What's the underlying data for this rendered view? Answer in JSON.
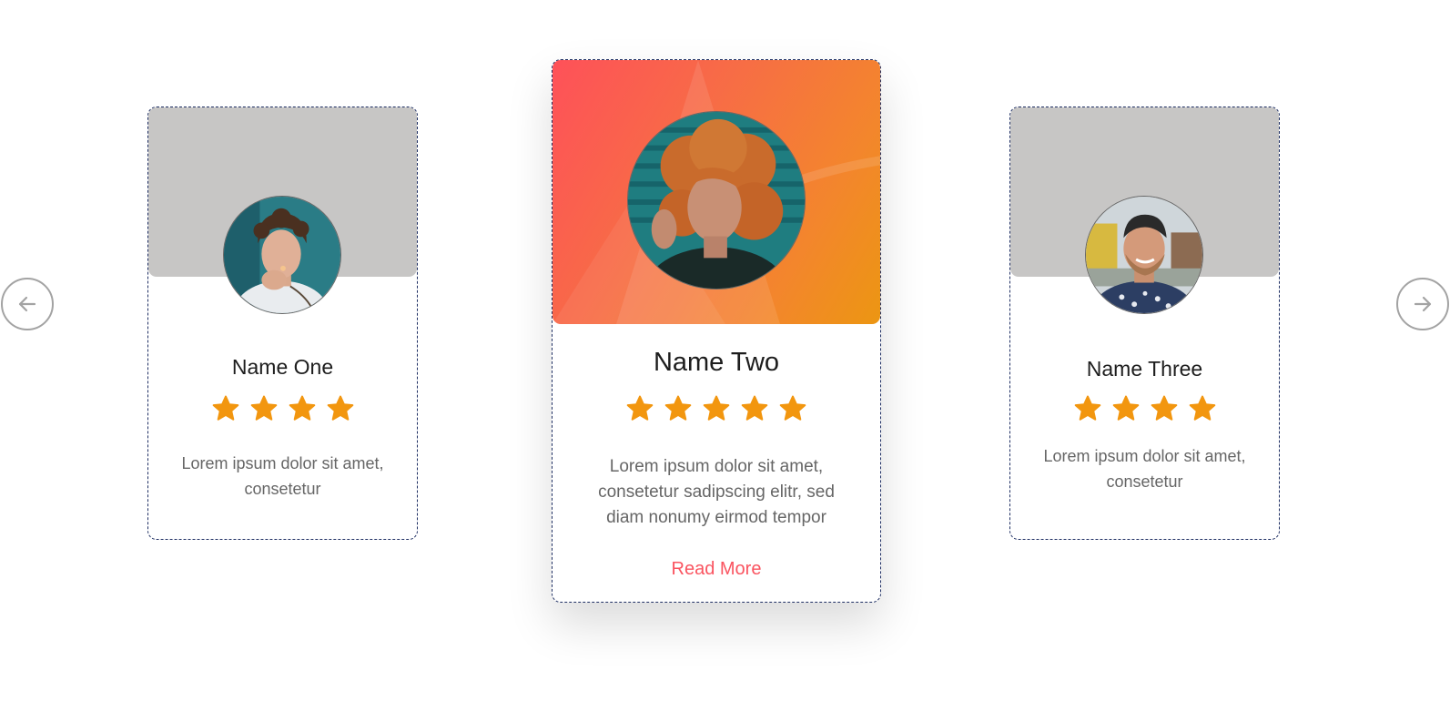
{
  "nav": {
    "prev_icon": "arrow-left-icon",
    "next_icon": "arrow-right-icon"
  },
  "colors": {
    "accent": "#fa5460",
    "star": "#f2960f",
    "gradient_start": "#fe5159",
    "gradient_end": "#ec9612",
    "banner_gray": "#c7c6c5"
  },
  "cards": [
    {
      "name": "Name One",
      "rating": 4,
      "description": "Lorem ipsum dolor sit amet, consetetur"
    },
    {
      "name": "Name Two",
      "rating": 5,
      "description": "Lorem ipsum dolor sit amet, consetetur sadipscing elitr, sed diam nonumy eirmod tempor",
      "link": "Read More"
    },
    {
      "name": "Name Three",
      "rating": 4,
      "description": "Lorem ipsum dolor sit amet, consetetur"
    }
  ]
}
